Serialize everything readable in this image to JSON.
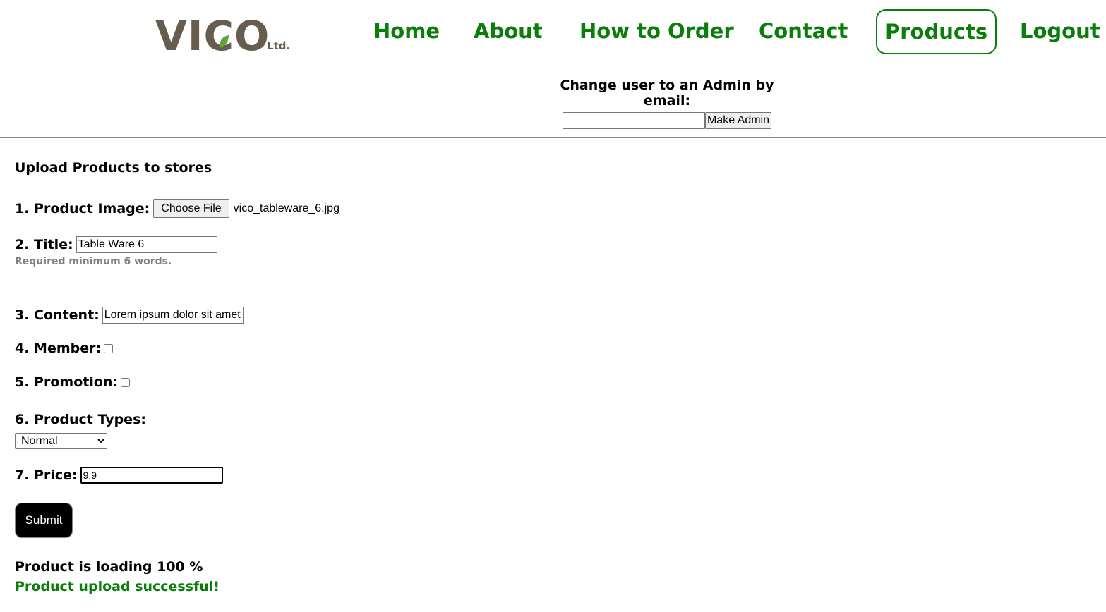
{
  "header": {
    "logo": {
      "brand": "VICO",
      "suffix": "Ltd."
    },
    "nav": [
      {
        "label": "Home"
      },
      {
        "label": "About"
      },
      {
        "label": "How to Order"
      },
      {
        "label": "Contact"
      },
      {
        "label": "Products",
        "active": true
      },
      {
        "label": "Logout"
      }
    ]
  },
  "admin": {
    "label": "Change user to an Admin by email:",
    "input_value": "",
    "button_label": "Make Admin"
  },
  "form": {
    "heading": "Upload Products to stores",
    "image": {
      "label": "1. Product Image:",
      "button_label": "Choose File",
      "file_name": "vico_tableware_6.jpg"
    },
    "title": {
      "label": "2. Title:",
      "value": "Table Ware 6",
      "hint": "Required minimum 6 words."
    },
    "content": {
      "label": "3. Content:",
      "value": "Lorem ipsum dolor sit amet"
    },
    "member": {
      "label": "4. Member:",
      "checked": false
    },
    "promotion": {
      "label": "5. Promotion:",
      "checked": false
    },
    "types": {
      "label": "6. Product Types:",
      "selected": "Normal"
    },
    "price": {
      "label": "7. Price:",
      "value": "9.9"
    },
    "submit_label": "Submit"
  },
  "status": {
    "loading": "Product is loading 100 %",
    "success": "Product upload successful!"
  },
  "colors": {
    "nav_green": "#0a7d0a",
    "logo_brown": "#675d4f",
    "hint_gray": "#808080"
  }
}
